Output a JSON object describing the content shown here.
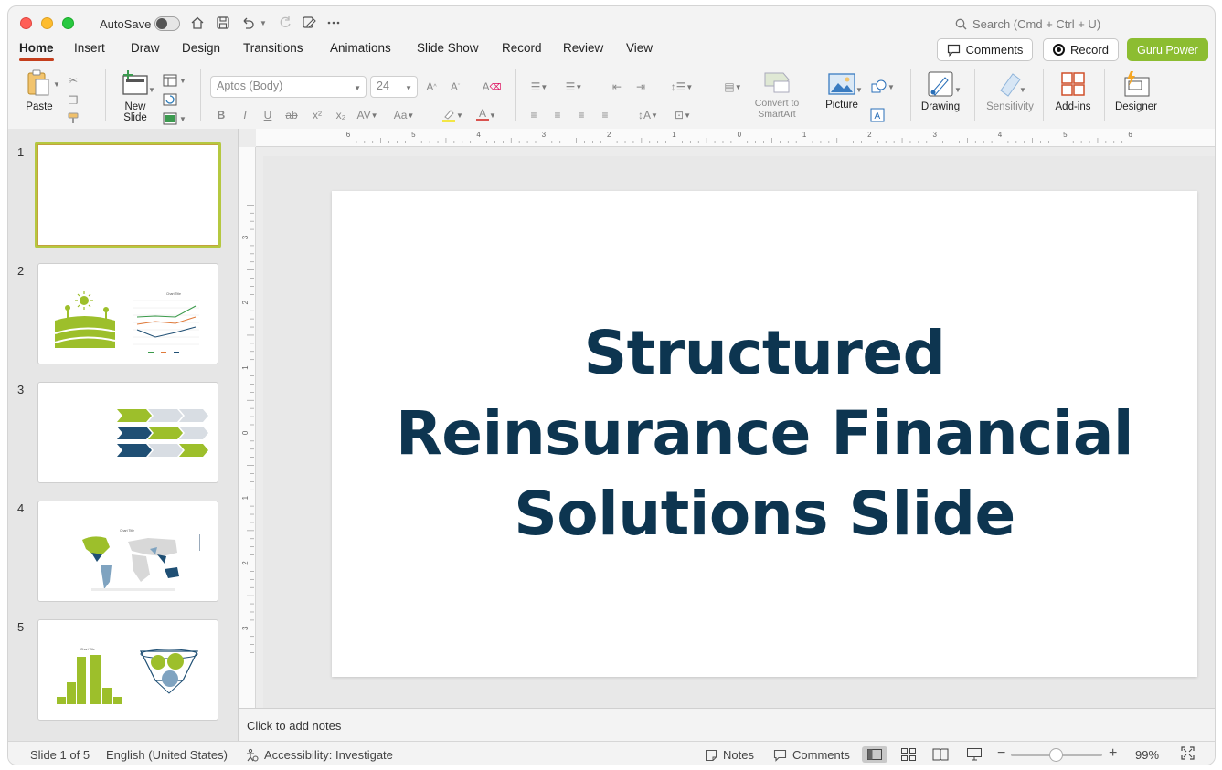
{
  "titlebar": {
    "autosave_label": "AutoSave",
    "search_placeholder": "Search (Cmd + Ctrl + U)"
  },
  "tabs": [
    "Home",
    "Insert",
    "Draw",
    "Design",
    "Transitions",
    "Animations",
    "Slide Show",
    "Record",
    "Review",
    "View"
  ],
  "active_tab": "Home",
  "header_buttons": {
    "comments": "Comments",
    "record": "Record",
    "guru": "Guru Power"
  },
  "ribbon": {
    "paste": "Paste",
    "new_slide": "New Slide",
    "font_name": "Aptos (Body)",
    "font_size": "24",
    "convert_smartart": "Convert to SmartArt",
    "picture": "Picture",
    "drawing": "Drawing",
    "sensitivity": "Sensitivity",
    "addins": "Add-ins",
    "designer": "Designer"
  },
  "slides": [
    {
      "number": "1"
    },
    {
      "number": "2",
      "chart_title": "Chart Title"
    },
    {
      "number": "3"
    },
    {
      "number": "4",
      "chart_title": "Chart Title"
    },
    {
      "number": "5",
      "chart_title": "Chart Title"
    }
  ],
  "ruler": {
    "top_labels": [
      "6",
      "5",
      "4",
      "3",
      "2",
      "1",
      "0",
      "1",
      "2",
      "3",
      "4",
      "5",
      "6"
    ],
    "left_labels": [
      "3",
      "2",
      "1",
      "0",
      "1",
      "2",
      "3"
    ]
  },
  "current_slide": {
    "title": "Structured Reinsurance Financial Solutions Slide"
  },
  "notes_placeholder": "Click to add notes",
  "statusbar": {
    "slide_info": "Slide 1 of 5",
    "language": "English (United States)",
    "accessibility": "Accessibility: Investigate",
    "notes": "Notes",
    "comments": "Comments",
    "zoom": "99%"
  },
  "colors": {
    "accent": "#c43e1c",
    "title_text": "#0d3550",
    "guru_button": "#8cbd31",
    "thumb_green": "#9dbf2b",
    "thumb_navy": "#1f4f74"
  }
}
